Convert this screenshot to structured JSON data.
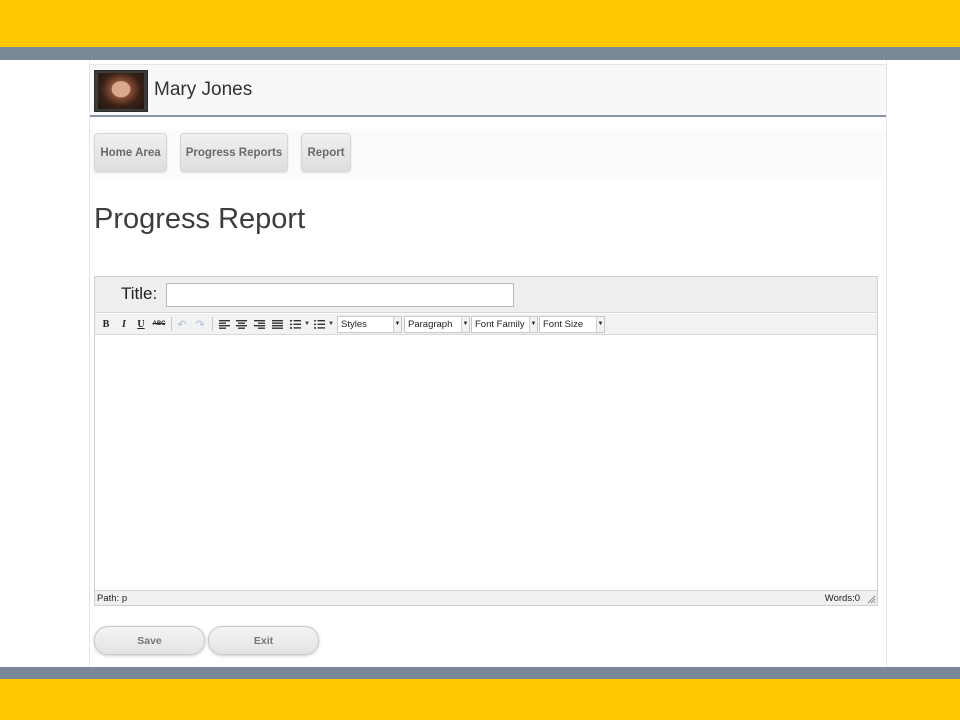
{
  "user": {
    "name": "Mary Jones"
  },
  "nav": [
    {
      "label": "Home Area"
    },
    {
      "label": "Progress Reports"
    },
    {
      "label": "Report"
    }
  ],
  "page": {
    "title": "Progress Report"
  },
  "editor": {
    "title_label": "Title:",
    "title_value": "",
    "toolbar": {
      "bold": "B",
      "italic": "I",
      "underline": "U",
      "strikethrough": "ABC",
      "undo_icon": "↶",
      "redo_icon": "↷",
      "styles": "Styles",
      "paragraph": "Paragraph",
      "font_family": "Font Family",
      "font_size": "Font Size"
    },
    "content": "",
    "status": {
      "path": "Path: p",
      "words": "Words:0"
    }
  },
  "actions": {
    "save": "Save",
    "exit": "Exit"
  },
  "colors": {
    "accent_band": "#ffc800",
    "stripe": "#7a8898"
  }
}
